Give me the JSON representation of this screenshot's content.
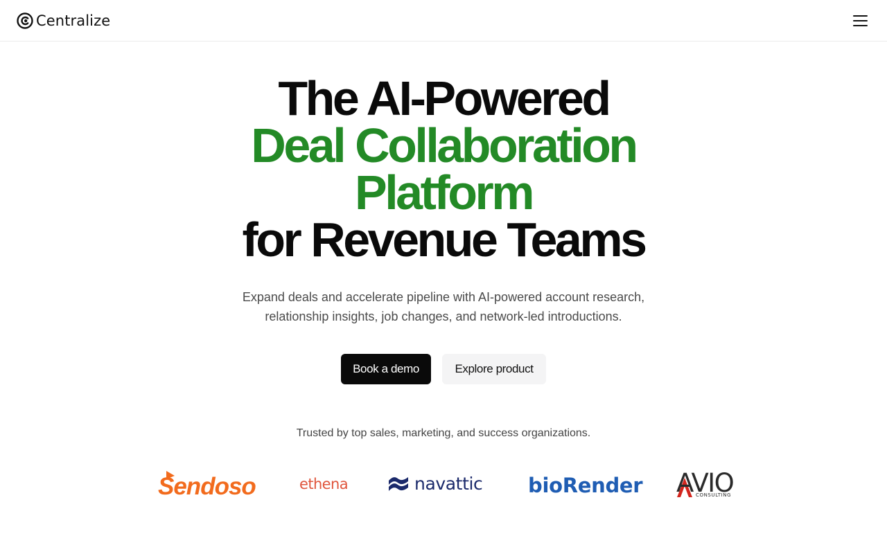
{
  "header": {
    "brand_name": "Centralize",
    "menu_icon": "hamburger-menu-icon"
  },
  "hero": {
    "title_line_1": "The AI-Powered",
    "title_line_2": "Deal Collaboration",
    "title_line_3": "Platform",
    "title_line_4": "for Revenue Teams",
    "accent_color": "#238a26",
    "subtitle": "Expand deals and accelerate pipeline with AI-powered account research, relationship insights, job changes, and network-led introductions."
  },
  "cta": {
    "primary_label": "Book a demo",
    "secondary_label": "Explore product"
  },
  "social_proof": {
    "caption": "Trusted by top sales, marketing, and success organizations.",
    "logos": [
      {
        "name": "Sendoso",
        "color": "#f26b1d"
      },
      {
        "name": "ethena",
        "color": "#e0553c"
      },
      {
        "name": "navattic",
        "color": "#1b2a6b"
      },
      {
        "name": "bioRender",
        "color": "#1f5db3"
      },
      {
        "name": "AVIO",
        "subtext": "CONSULTING",
        "color": "#2a2a2a"
      }
    ]
  }
}
